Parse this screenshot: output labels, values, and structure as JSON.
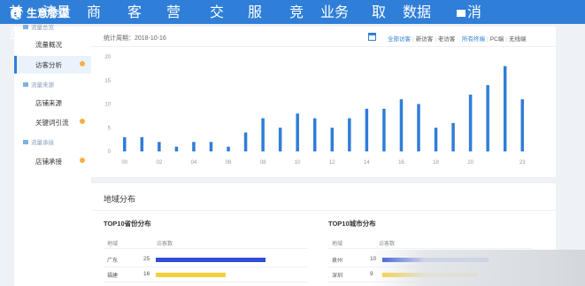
{
  "app": {
    "name": "生意参谋"
  },
  "nav": [
    {
      "label": "首页",
      "x": 90,
      "w": 20,
      "active": false,
      "dot": false
    },
    {
      "label": "流量",
      "x": 128,
      "w": 40,
      "active": true,
      "dot": true
    },
    {
      "label": "商品",
      "x": 178,
      "w": 24,
      "active": false,
      "dot": true
    },
    {
      "label": "客户",
      "x": 224,
      "w": 24,
      "active": false,
      "dot": true
    },
    {
      "label": "营销",
      "x": 268,
      "w": 24,
      "active": false,
      "dot": true
    },
    {
      "label": "交易",
      "x": 317,
      "w": 20,
      "active": false,
      "dot": false
    },
    {
      "label": "服务",
      "x": 360,
      "w": 20,
      "active": false,
      "dot": false
    },
    {
      "label": "竞争",
      "x": 407,
      "w": 20,
      "active": false,
      "dot": false
    },
    {
      "label": "业务专区",
      "x": 442,
      "w": 40,
      "active": false,
      "dot": false
    },
    {
      "label": "取数",
      "x": 500,
      "w": 20,
      "active": false,
      "dot": false
    },
    {
      "label": "数据学院",
      "x": 535,
      "w": 40,
      "active": false,
      "dot": false
    },
    {
      "label": "消息",
      "x": 596,
      "w": 30,
      "active": false,
      "dot": true
    }
  ],
  "sidebar": {
    "group1_label": "流量总览",
    "flow_overview": "流量概况",
    "visitor_analysis": "访客分析",
    "group2_label": "流量来源",
    "store_source": "店铺来源",
    "keyword_flow": "关键词引流",
    "group3_label": "流量承接",
    "store_carry": "店铺承接"
  },
  "period": "统计周期：2018-10-16",
  "filters": [
    {
      "label": "全部访客",
      "selected": true
    },
    {
      "label": "新访客",
      "selected": false
    },
    {
      "label": "老访客",
      "selected": false
    },
    {
      "label": "所有终端",
      "selected": true
    },
    {
      "label": "PC端",
      "selected": false
    },
    {
      "label": "无线端",
      "selected": false
    }
  ],
  "chart_data": {
    "type": "bar",
    "x": [
      "00",
      "01",
      "02",
      "03",
      "04",
      "05",
      "06",
      "07",
      "08",
      "09",
      "10",
      "11",
      "12",
      "13",
      "14",
      "15",
      "16",
      "17",
      "18",
      "19",
      "20",
      "21",
      "22",
      "23"
    ],
    "x_tick_labels": [
      "00",
      "02",
      "04",
      "06",
      "08",
      "10",
      "12",
      "14",
      "16",
      "18",
      "20",
      "23"
    ],
    "values": [
      3,
      3,
      2,
      1,
      2,
      2,
      1,
      4,
      7,
      5,
      8,
      7,
      5,
      7,
      9,
      9,
      11,
      10,
      5,
      6,
      12,
      14,
      18,
      11
    ],
    "ylim": [
      0,
      20
    ],
    "y_ticks": [
      0,
      5,
      10,
      15,
      20
    ],
    "grid": false,
    "color": "#2f7ed8"
  },
  "geo": {
    "title": "地域分布",
    "province": {
      "title": "TOP10省份分布",
      "col_region": "地域",
      "col_visitors": "访客数",
      "rows": [
        {
          "name": "广东",
          "value": 25,
          "color": "#2f4fd8",
          "fill_pct": 100
        },
        {
          "name": "福建",
          "value": 16,
          "color": "#f5d03c",
          "fill_pct": 64
        }
      ]
    },
    "city": {
      "title": "TOP10城市分布",
      "col_region": "地域",
      "col_visitors": "访客数",
      "rows": [
        {
          "name": "泉州",
          "value": 10,
          "color": "#2f4fd8",
          "fill_pct": 100
        },
        {
          "name": "深圳",
          "value": 9,
          "color": "#f5d03c",
          "fill_pct": 90
        }
      ]
    }
  }
}
